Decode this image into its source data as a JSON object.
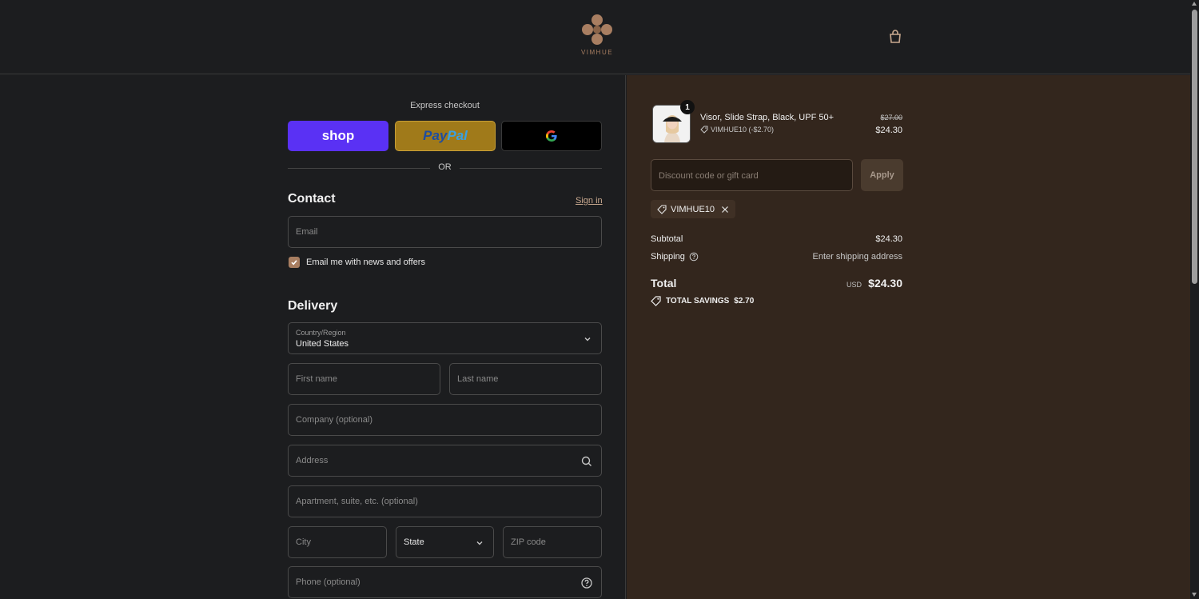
{
  "header": {
    "brand": "VIMHUE",
    "cart_icon": "shopping-bag-icon"
  },
  "express": {
    "label": "Express checkout",
    "shop_label": "shop",
    "paypal_label_a": "Pay",
    "paypal_label_b": "Pal",
    "google_icon": "google-icon",
    "or_text": "OR"
  },
  "contact": {
    "title": "Contact",
    "signin": "Sign in",
    "email_placeholder": "Email",
    "newsletter_label": "Email me with news and offers",
    "newsletter_checked": true
  },
  "delivery": {
    "title": "Delivery",
    "country_label": "Country/Region",
    "country_value": "United States",
    "first_name_placeholder": "First name",
    "last_name_placeholder": "Last name",
    "company_placeholder": "Company (optional)",
    "address_placeholder": "Address",
    "apartment_placeholder": "Apartment, suite, etc. (optional)",
    "city_placeholder": "City",
    "state_value": "State",
    "zip_placeholder": "ZIP code",
    "phone_placeholder": "Phone (optional)"
  },
  "order": {
    "product_name": "Visor, Slide Strap, Black, UPF 50+",
    "product_code": "VIMHUE10 (-$2.70)",
    "quantity": "1",
    "price_old": "$27.00",
    "price_new": "$24.30",
    "discount_placeholder": "Discount code or gift card",
    "apply_label": "Apply",
    "applied_code": "VIMHUE10",
    "subtotal_label": "Subtotal",
    "subtotal_value": "$24.30",
    "shipping_label": "Shipping",
    "shipping_value": "Enter shipping address",
    "total_label": "Total",
    "total_currency": "USD",
    "total_value": "$24.30",
    "savings_label": "TOTAL SAVINGS",
    "savings_value": "$2.70"
  },
  "colors": {
    "accent": "#a87e61",
    "summary_bg": "#33261d",
    "page_bg": "#1c1d1f",
    "shop_purple": "#5a31f4",
    "paypal_gold": "#a07a1a"
  }
}
